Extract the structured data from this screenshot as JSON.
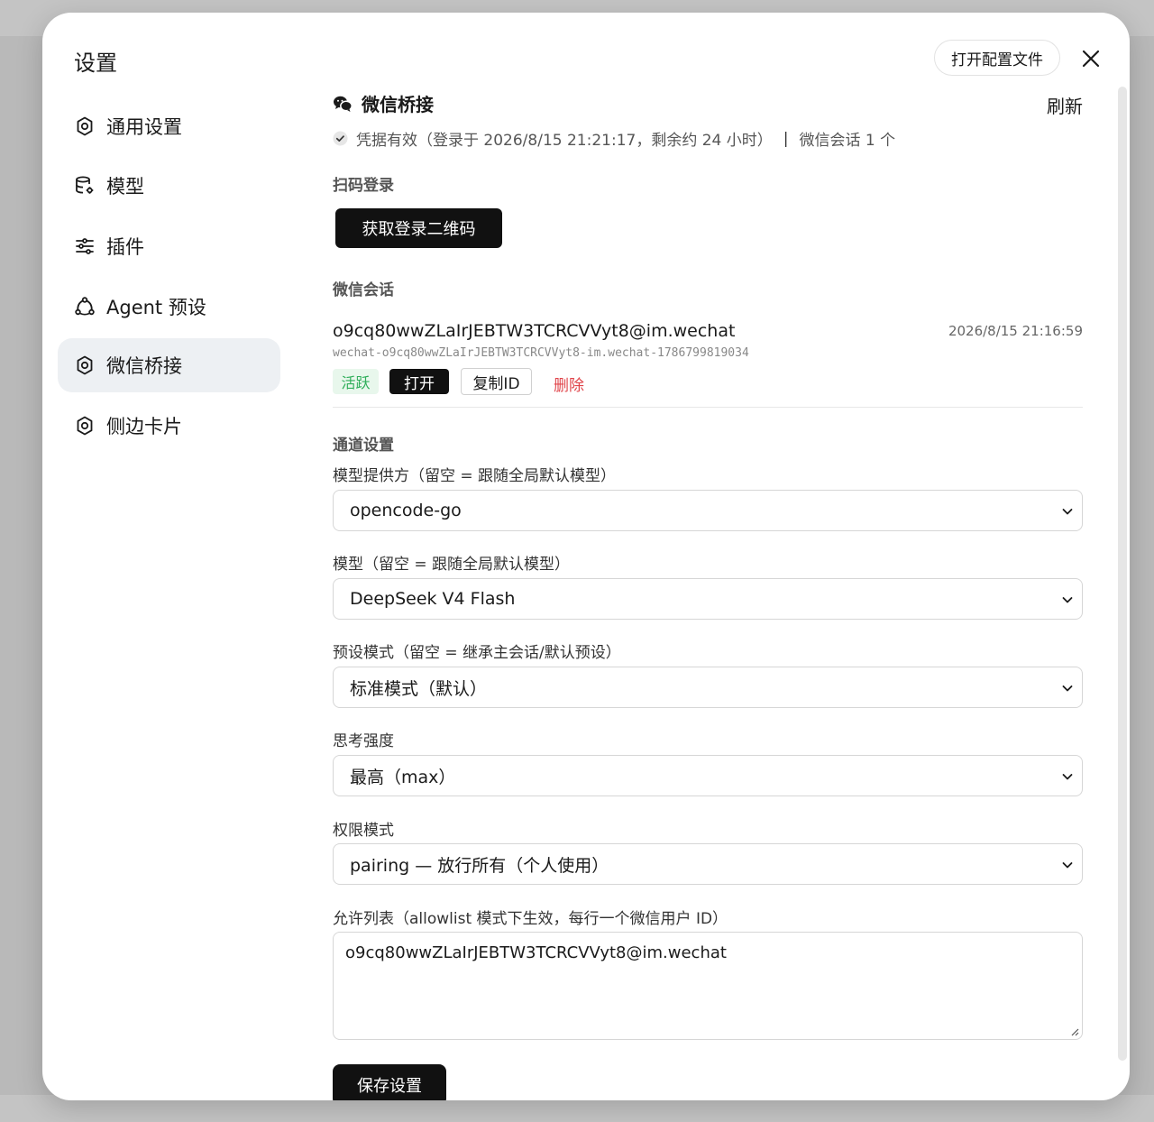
{
  "modal": {
    "title": "设置",
    "open_config_label": "打开配置文件"
  },
  "sidebar": {
    "items": [
      {
        "label": "通用设置",
        "icon": "gear-icon"
      },
      {
        "label": "模型",
        "icon": "database-icon"
      },
      {
        "label": "插件",
        "icon": "sliders-icon"
      },
      {
        "label": "Agent 预设",
        "icon": "agent-icon"
      },
      {
        "label": "微信桥接",
        "icon": "gear-icon",
        "active": true
      },
      {
        "label": "侧边卡片",
        "icon": "gear-icon"
      }
    ]
  },
  "wechat": {
    "title": "微信桥接",
    "refresh_label": "刷新",
    "credential_status": "凭据有效（登录于 2026/8/15 21:21:17，剩余约 24 小时）",
    "separator": "|",
    "session_count": "微信会话 1 个",
    "qr_heading": "扫码登录",
    "qr_button": "获取登录二维码",
    "sessions_heading": "微信会话",
    "session": {
      "id": "o9cq80wwZLaIrJEBTW3TCRCVVyt8@im.wechat",
      "time": "2026/8/15 21:16:59",
      "sub_id": "wechat-o9cq80wwZLaIrJEBTW3TCRCVVyt8-im.wechat-1786799819034",
      "status_tag": "活跃",
      "open_label": "打开",
      "copy_label": "复制ID",
      "delete_label": "删除"
    }
  },
  "channel": {
    "heading": "通道设置",
    "provider_label": "模型提供方（留空 = 跟随全局默认模型）",
    "provider_value": "opencode-go",
    "model_label": "模型（留空 = 跟随全局默认模型）",
    "model_value": "DeepSeek V4 Flash",
    "preset_label": "预设模式（留空 = 继承主会话/默认预设）",
    "preset_value": "标准模式（默认）",
    "thinking_label": "思考强度",
    "thinking_value": "最高（max）",
    "permission_label": "权限模式",
    "permission_value": "pairing — 放行所有（个人使用）",
    "allowlist_label": "允许列表（allowlist 模式下生效，每行一个微信用户 ID）",
    "allowlist_value": "o9cq80wwZLaIrJEBTW3TCRCVVyt8@im.wechat",
    "save_label": "保存设置"
  },
  "colors": {
    "accent": "#111111",
    "active_tag_bg": "#e8f7ec",
    "active_tag_text": "#2fae5a",
    "delete_text": "#e0444a",
    "sidebar_active_bg": "#edf0f3"
  }
}
